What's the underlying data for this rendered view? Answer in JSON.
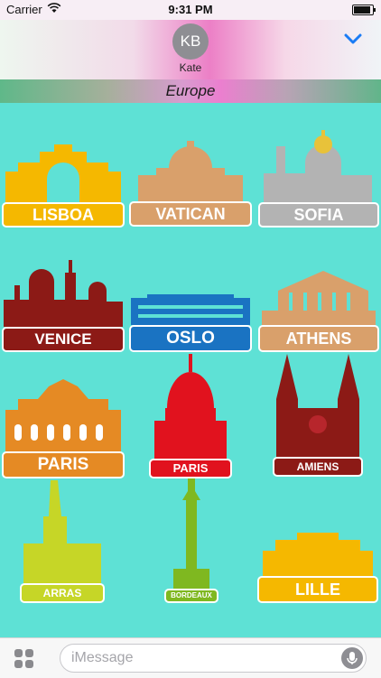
{
  "status_bar": {
    "carrier": "Carrier",
    "time": "9:31 PM",
    "wifi_icon": "wifi-icon",
    "battery_icon": "battery-icon"
  },
  "header": {
    "avatar_initials": "KB",
    "contact_name": "Kate",
    "collapse_icon": "chevron-down-icon"
  },
  "pack": {
    "title": "Europe"
  },
  "stickers": [
    {
      "label": "LISBOA",
      "color": "#f5b800"
    },
    {
      "label": "VATICAN",
      "color": "#d9a06b"
    },
    {
      "label": "SOFIA",
      "color": "#b3b3b3"
    },
    {
      "label": "VENICE",
      "color": "#8c1a16"
    },
    {
      "label": "OSLO",
      "color": "#1a73c2"
    },
    {
      "label": "ATHENS",
      "color": "#d9a06b"
    },
    {
      "label": "PARIS",
      "color": "#e58a24"
    },
    {
      "label": "PARIS",
      "color": "#e1121e"
    },
    {
      "label": "AMIENS",
      "color": "#8c1a16"
    },
    {
      "label": "ARRAS",
      "color": "#c6d627"
    },
    {
      "label": "BORDEAUX",
      "color": "#7fb820"
    },
    {
      "label": "LILLE",
      "color": "#f5b800"
    }
  ],
  "input": {
    "placeholder": "iMessage",
    "apps_icon": "app-drawer-icon",
    "mic_icon": "microphone-icon"
  }
}
